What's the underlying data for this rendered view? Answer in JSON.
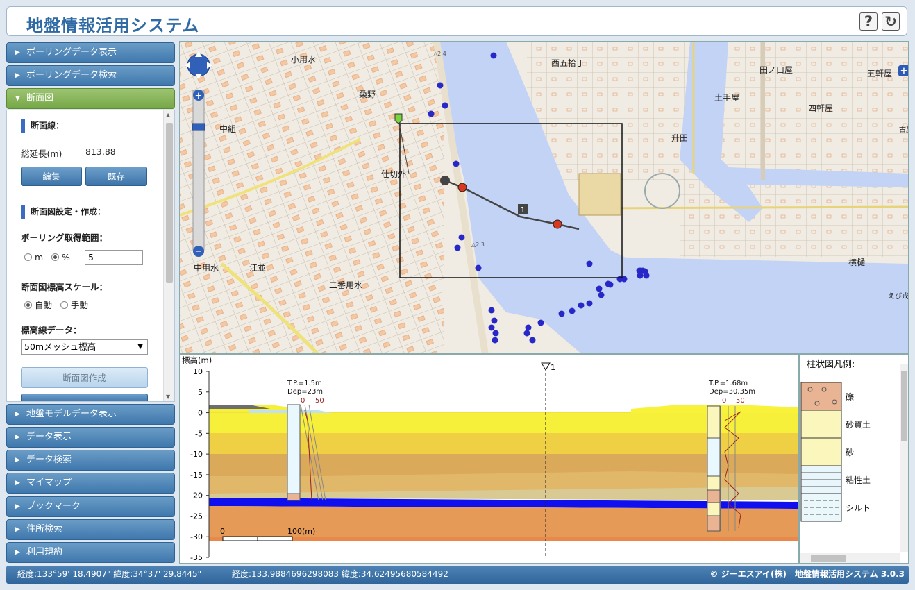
{
  "app": {
    "title": "地盤情報活用システム",
    "help_glyph": "?",
    "refresh_glyph": "↻"
  },
  "sidebar": {
    "items_top": [
      {
        "label": "ボーリングデータ表示"
      },
      {
        "label": "ボーリングデータ検索"
      },
      {
        "label": "断面図"
      }
    ],
    "items_bottom": [
      {
        "label": "地盤モデルデータ表示"
      },
      {
        "label": "データ表示"
      },
      {
        "label": "データ検索"
      },
      {
        "label": "マイマップ"
      },
      {
        "label": "ブックマーク"
      },
      {
        "label": "住所検索"
      },
      {
        "label": "利用規約"
      }
    ]
  },
  "panel": {
    "section_line": "断面線：",
    "total_length_label": "総延長(m)",
    "total_length_value": "813.88",
    "edit_button": "編集",
    "existing_button": "既存",
    "section_settings": "断面図設定・作成：",
    "boring_range_label": "ボーリング取得範囲：",
    "unit_m": "m",
    "unit_pct": "%",
    "range_value": "5",
    "elev_scale_label": "断面図標高スケール：",
    "auto_label": "自動",
    "manual_label": "手動",
    "elev_data_label": "標高線データ：",
    "elev_data_selected": "50mメッシュ標高",
    "create_button": "断面図作成"
  },
  "map": {
    "labels": {
      "kakuma": "中組",
      "kuwano": "桑野",
      "kowaimizu": "小用水",
      "shikiri": "仕切外",
      "nakayou": "中用水",
      "enami": "江並",
      "nibanyou": "二番用水",
      "nishigoju": "西五拾丁",
      "tenote": "土手屋",
      "shoden": "升田",
      "tanoya": "田ノ口屋",
      "goken": "五軒屋",
      "yonken": "四軒屋",
      "yokohi": "横樋",
      "ebisu": "えび戎町",
      "koyama": "古屋",
      "road_top": "△2.4",
      "road_mid": "△2.3"
    },
    "section_label": "1"
  },
  "section_chart": {
    "y_axis_title": "標高(m)",
    "ylim": [
      -35,
      10
    ],
    "y_ticks": [
      "10",
      "5",
      "0",
      "-5",
      "-10",
      "-15",
      "-20",
      "-25",
      "-30",
      "-35"
    ],
    "section_marker": "1",
    "scale_left": "0",
    "scale_right": "100(m)",
    "boring1": {
      "tp": "T.P.=1.5m",
      "dep": "Dep=23m",
      "n0": "0",
      "n50": "50"
    },
    "boring2": {
      "tp": "T.P.=1.68m",
      "dep": "Dep=30.35m",
      "n0": "0",
      "n50": "50"
    }
  },
  "chart_data": {
    "type": "area",
    "title": "",
    "xlabel": "",
    "ylabel": "標高(m)",
    "ylim": [
      -35,
      10
    ],
    "boreholes": [
      {
        "tp": 1.5,
        "depth": 23
      },
      {
        "tp": 1.68,
        "depth": 30.35
      }
    ]
  },
  "legend": {
    "title": "柱状図凡例:",
    "items": [
      {
        "label": "礫",
        "color": "#e9b493"
      },
      {
        "label": "砂質土",
        "color": "#fbf6bc"
      },
      {
        "label": "砂",
        "color": "#fbf6bc"
      },
      {
        "label": "粘性土",
        "color": "#e8f6fb"
      },
      {
        "label": "シルト",
        "color": "#eaf7fb"
      }
    ]
  },
  "status": {
    "coords_dms": "経度:133°59' 18.4907\" 緯度:34°37' 29.8445\"",
    "coords_dec": "経度:133.9884696298083 緯度:34.62495680584492",
    "copyright": "© ジーエスアイ(株)　地盤情報活用システム 3.0.3"
  }
}
